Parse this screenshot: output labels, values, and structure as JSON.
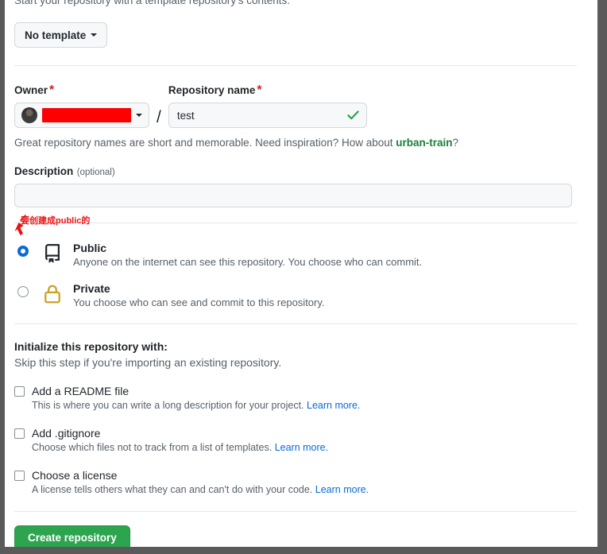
{
  "template_section": {
    "description": "Start your repository with a template repository's contents.",
    "button_label": "No template",
    "caret_icon": "chevron-down-icon"
  },
  "owner": {
    "label": "Owner",
    "required_mark": "*",
    "avatar_icon": "user-avatar",
    "value": "",
    "redacted": true,
    "caret_icon": "chevron-down-icon"
  },
  "separator": "/",
  "repository_name": {
    "label": "Repository name",
    "required_mark": "*",
    "value": "test",
    "placeholder": "",
    "valid_icon": "check-icon"
  },
  "name_hint": {
    "prefix": "Great repository names are short and memorable. Need inspiration? How about ",
    "suggestion": "urban-train",
    "suffix": "?"
  },
  "description": {
    "label": "Description",
    "optional_label": "(optional)",
    "value": "",
    "placeholder": ""
  },
  "visibility": {
    "options": [
      {
        "id": "public",
        "title": "Public",
        "subtitle": "Anyone on the internet can see this repository. You choose who can commit.",
        "icon": "repo-icon",
        "selected": true
      },
      {
        "id": "private",
        "title": "Private",
        "subtitle": "You choose who can see and commit to this repository.",
        "icon": "lock-icon",
        "selected": false
      }
    ]
  },
  "initialize": {
    "title": "Initialize this repository with:",
    "subtitle": "Skip this step if you're importing an existing repository.",
    "items": [
      {
        "label": "Add a README file",
        "checked": false,
        "description": "This is where you can write a long description for your project. ",
        "link_text": "Learn more.",
        "checkbox_icon": "checkbox-unchecked-icon"
      },
      {
        "label": "Add .gitignore",
        "checked": false,
        "description": "Choose which files not to track from a list of templates. ",
        "link_text": "Learn more.",
        "checkbox_icon": "checkbox-unchecked-icon"
      },
      {
        "label": "Choose a license",
        "checked": false,
        "description": "A license tells others what they can and can't do with your code. ",
        "link_text": "Learn more.",
        "checkbox_icon": "checkbox-unchecked-icon"
      }
    ]
  },
  "submit": {
    "label": "Create repository"
  },
  "annotation": {
    "text": "要创建成public的",
    "arrow_icon": "red-arrow-icon",
    "color": "#ee1111"
  },
  "colors": {
    "accent_green": "#2da44e",
    "link_blue": "#0969da",
    "suggestion_green": "#1a7f37",
    "required_red": "#cf222e",
    "redaction_red": "#fe0000",
    "lock_gold": "#c9a227",
    "annotation_red": "#ee1111"
  }
}
